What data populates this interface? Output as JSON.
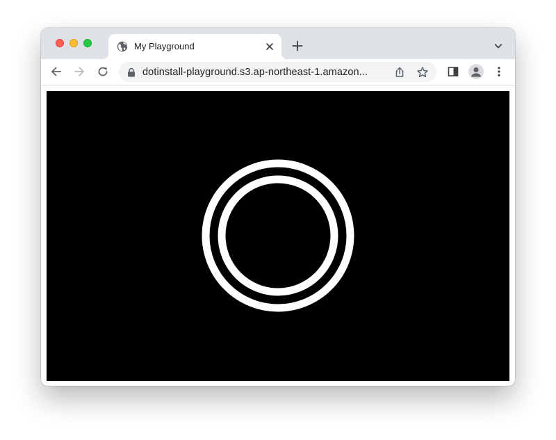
{
  "window": {
    "controls": [
      "close",
      "minimize",
      "maximize"
    ]
  },
  "tab": {
    "title": "My Playground",
    "favicon": "globe-icon"
  },
  "toolbar": {
    "url": "dotinstall-playground.s3.ap-northeast-1.amazon...",
    "icons": [
      "back-arrow-icon",
      "forward-arrow-icon",
      "reload-icon",
      "lock-icon",
      "share-icon",
      "bookmark-star-icon",
      "side-panel-icon",
      "profile-icon",
      "menu-dots-icon"
    ]
  },
  "canvas": {
    "background": "#000000",
    "stroke_color": "#ffffff",
    "shapes": [
      "outer-ring",
      "inner-ring"
    ]
  },
  "colors": {
    "tabstrip": "#dee1e6",
    "omnibox": "#f1f3f4",
    "text": "#202124",
    "icon": "#5f6368"
  }
}
